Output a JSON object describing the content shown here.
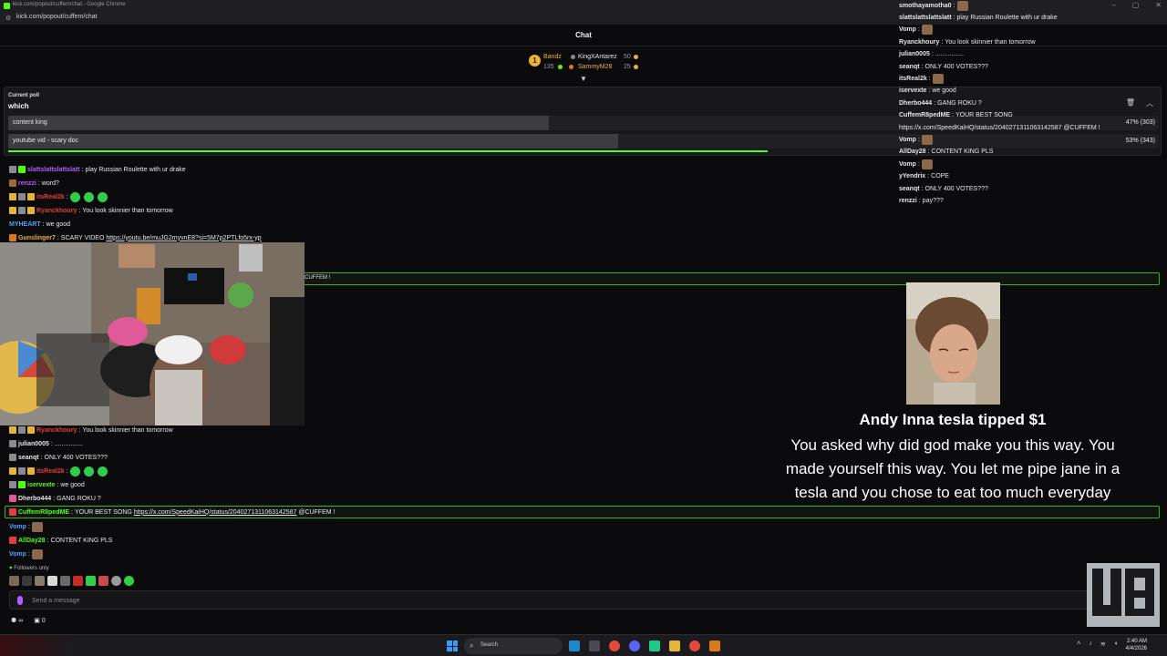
{
  "browser": {
    "window_title": "kick.com/popout/cuffem/chat - Google Chrome",
    "url": "kick.com/popout/cuffem/chat"
  },
  "chat": {
    "title": "Chat",
    "leaderboard": {
      "rank": "1",
      "top_name": "Bandz",
      "top_value": "135",
      "entries": [
        {
          "name": "KingXAntarez",
          "value": "50"
        },
        {
          "name": "SammyM28",
          "value": "25"
        }
      ]
    }
  },
  "poll": {
    "label": "Current poll",
    "question": "which",
    "options": [
      {
        "label": "content king",
        "percent": 47,
        "display": "47% (303)",
        "votes": 303
      },
      {
        "label": "youtube vid - scary doc",
        "percent": 53,
        "display": "53% (343)",
        "votes": 343
      }
    ],
    "time_remaining_fraction": 0.66
  },
  "messages_top": [
    {
      "user": "slattslattslattslatt",
      "text": "play Russian Roulette with ur drake",
      "user_color": "#b25cff"
    },
    {
      "user": "renzzi",
      "text": "word?",
      "user_color": "#b25cff"
    },
    {
      "user": "itsReal2k",
      "text": "",
      "user_color": "#e23c3c"
    },
    {
      "user": "Ryanckhoury",
      "text": "You look skinnier than tomorrow",
      "user_color": "#e23c3c"
    },
    {
      "user": "MYHEART",
      "text": "we good",
      "user_color": "#4aa3ff"
    },
    {
      "user": "Gunslinger7",
      "text": "SCARY VIDEO",
      "link": "https://youtu.be/muJG2myvnE8?si=5M7p2PTLfo5rx-yp",
      "user_color": "#e7b43a"
    }
  ],
  "messages_bottom": [
    {
      "user": "Ryanckhoury",
      "text": "You look skinnier than tomorrow",
      "user_color": "#e23c3c"
    },
    {
      "user": "julian0005",
      "text": "................",
      "user_color": "#e6e6e6"
    },
    {
      "user": "seanqt",
      "text": "ONLY 400 VOTES???",
      "user_color": "#e6e6e6"
    },
    {
      "user": "itsReal2k",
      "text": "",
      "user_color": "#e23c3c"
    },
    {
      "user": "iservexte",
      "text": "we good",
      "user_color": "#53fc18"
    },
    {
      "user": "Dherbo444",
      "text": "GANG ROKU ?",
      "user_color": "#e6e6e6"
    },
    {
      "user": "CuffemR8pedME",
      "text": "YOUR BEST SONG",
      "link": "https://x.com/SpeedKaiHQ/status/2040271311063142587",
      "suffix": "@CUFFEM !",
      "user_color": "#53fc18"
    },
    {
      "user": "Vomp",
      "text": "",
      "user_color": "#4aa3ff"
    },
    {
      "user": "AllDay28",
      "text": "CONTENT KING PLS",
      "user_color": "#53fc18"
    },
    {
      "user": "Vomp",
      "text": "",
      "user_color": "#4aa3ff"
    }
  ],
  "partial_highlight_text": "CUFFEM !",
  "overlay_chat": [
    {
      "user": "smothayamotha0",
      "text": ""
    },
    {
      "user": "slattslattslattslatt",
      "text": "play Russian Roulette with ur drake"
    },
    {
      "user": "Vomp",
      "text": ""
    },
    {
      "user": "Ryanckhoury",
      "text": "You look skinnier than tomorrow"
    },
    {
      "user": "julian0005",
      "text": "................"
    },
    {
      "user": "seanqt",
      "text": "ONLY 400 VOTES???"
    },
    {
      "user": "itsReal2k",
      "text": ""
    },
    {
      "user": "iservexte",
      "text": "we good"
    },
    {
      "user": "Dherbo444",
      "text": "GANG ROKU ?"
    },
    {
      "user": "CuffemR8pedME",
      "text": "YOUR BEST SONG"
    },
    {
      "user": "",
      "text": "https://x.com/SpeedKaiHQ/status/2040271311063142587 @CUFFEM !"
    },
    {
      "user": "Vomp",
      "text": ""
    },
    {
      "user": "AllDay28",
      "text": "CONTENT KING PLS"
    },
    {
      "user": "Vomp",
      "text": ""
    },
    {
      "user": "yYendrix",
      "text": "COPE"
    },
    {
      "user": "seanqt",
      "text": "ONLY 400 VOTES???"
    },
    {
      "user": "renzzi",
      "text": "pay???"
    }
  ],
  "tip": {
    "title": "Andy Inna tesla tipped $1",
    "message": "You asked why did god make you this way. You made yourself this way. You let me pipe jane in a tesla and you chose to eat too much everyday"
  },
  "chat_footer": {
    "followers_only": "Followers only",
    "input_placeholder": "Send a message",
    "viewers": "∞",
    "gifts": "0"
  },
  "taskbar": {
    "search_label": "Search",
    "time": "2:40 AM",
    "date": "4/4/2026"
  },
  "colors": {
    "accent": "#53fc18",
    "background": "#0b0b0d",
    "poll_bar": "#3c3c41"
  }
}
